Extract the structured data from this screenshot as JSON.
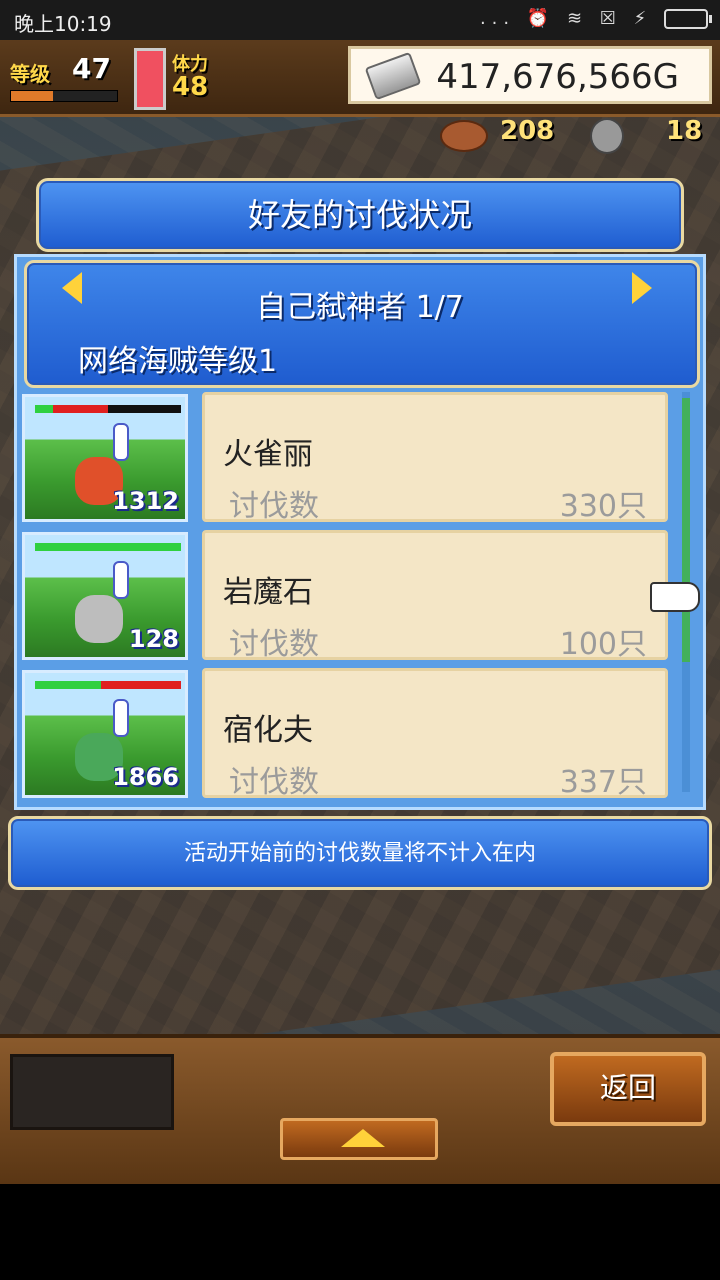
{
  "status_bar": {
    "time": "晚上10:19",
    "icons": "... ⏰ ≋ ☒ ⚡"
  },
  "hud": {
    "level_label": "等级",
    "level_value": "47",
    "level_progress": 0.4,
    "stamina_label": "体力",
    "stamina_value": "48",
    "gold": "417,676,566G",
    "resource_1": "208",
    "resource_2": "18"
  },
  "dialog": {
    "title": "好友的讨伐状况",
    "player_name": "自己弑神者 1/7",
    "player_level": "网络海贼等级1",
    "notice": "活动开始前的讨伐数量将不计入在内"
  },
  "rows": [
    {
      "name": "火雀丽",
      "kill_label": "讨伐数",
      "kill_count": "330只",
      "power": "1312",
      "hp_green": 0.12,
      "hp_red": 0.38,
      "monster_color": "#e0502a"
    },
    {
      "name": "岩魔石",
      "kill_label": "讨伐数",
      "kill_count": "100只",
      "power": "128",
      "hp_green": 1.0,
      "hp_red": 0.0,
      "monster_color": "#bdbdbd"
    },
    {
      "name": "宿化夫",
      "kill_label": "讨伐数",
      "kill_count": "337只",
      "power": "1866",
      "hp_green": 0.45,
      "hp_red": 0.55,
      "monster_color": "#4aa85a"
    }
  ],
  "buttons": {
    "back": "返回"
  },
  "colors": {
    "dialog_blue": "#1e5cd0",
    "card_bg": "#f4e6c6",
    "accent_gold": "#ffd23a"
  }
}
